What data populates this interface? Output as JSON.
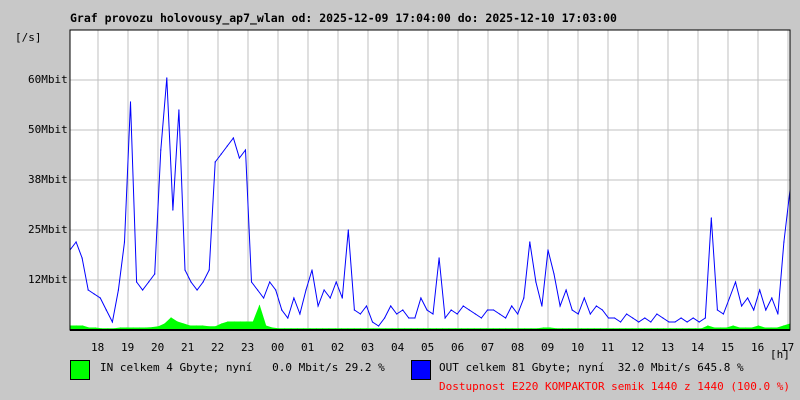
{
  "chart_data": {
    "type": "line",
    "title": "Graf provozu holovousy_ap7_wlan od: 2025-12-09 17:04:00 do: 2025-12-10 17:03:00",
    "ylabel": "[/s]",
    "xlabel": "[h]",
    "ylim": [
      0,
      75
    ],
    "y_unit": "Mbit",
    "yticks": [
      {
        "value": 12.5,
        "label": "12Mbit"
      },
      {
        "value": 25,
        "label": "25Mbit"
      },
      {
        "value": 37.5,
        "label": "38Mbit"
      },
      {
        "value": 50,
        "label": "50Mbit"
      },
      {
        "value": 62.5,
        "label": "60Mbit"
      }
    ],
    "xticks": [
      "18",
      "19",
      "20",
      "21",
      "22",
      "23",
      "00",
      "01",
      "02",
      "03",
      "04",
      "05",
      "06",
      "07",
      "08",
      "09",
      "10",
      "11",
      "12",
      "13",
      "14",
      "15",
      "16",
      "17"
    ],
    "x_start_hour_offset": 0.933,
    "samples_per_hour": 5,
    "grid": true,
    "series": [
      {
        "name": "IN",
        "color": "#00ff00",
        "fill": true,
        "values": [
          1,
          1,
          1,
          0.5,
          0.5,
          0.3,
          0.3,
          0.3,
          0.5,
          0.5,
          0.5,
          0.5,
          0.5,
          0.6,
          0.8,
          1.5,
          3,
          2,
          1.5,
          1,
          1,
          1,
          0.8,
          0.8,
          1.5,
          2,
          2,
          2,
          2,
          2,
          6,
          1,
          0.5,
          0.3,
          0.3,
          0.3,
          0.3,
          0.3,
          0.3,
          0.3,
          0.3,
          0.3,
          0.3,
          0.3,
          0.3,
          0.3,
          0.3,
          0.3,
          0.3,
          0.3,
          0.3,
          0.3,
          0.3,
          0.3,
          0.3,
          0.3,
          0.3,
          0.3,
          0.3,
          0.3,
          0.3,
          0.3,
          0.3,
          0.3,
          0.3,
          0.3,
          0.3,
          0.3,
          0.3,
          0.3,
          0.3,
          0.3,
          0.3,
          0.3,
          0.3,
          0.5,
          0.5,
          0.3,
          0.3,
          0.3,
          0.3,
          0.3,
          0.3,
          0.3,
          0.3,
          0.3,
          0.3,
          0.3,
          0.3,
          0.3,
          0.3,
          0.3,
          0.3,
          0.3,
          0.3,
          0.3,
          0.3,
          0.3,
          0.3,
          0.3,
          0.3,
          1,
          0.5,
          0.5,
          0.5,
          1,
          0.5,
          0.5,
          0.5,
          1,
          0.5,
          0.5,
          0.5,
          1,
          1.5
        ]
      },
      {
        "name": "OUT",
        "color": "#0000ff",
        "fill": false,
        "values": [
          20,
          22,
          18,
          10,
          9,
          8,
          5,
          2,
          10,
          22,
          57,
          12,
          10,
          12,
          14,
          45,
          63,
          30,
          55,
          15,
          12,
          10,
          12,
          15,
          42,
          44,
          46,
          48,
          43,
          45,
          12,
          10,
          8,
          12,
          10,
          5,
          3,
          8,
          4,
          10,
          15,
          6,
          10,
          8,
          12,
          8,
          25,
          5,
          4,
          6,
          2,
          1,
          3,
          6,
          4,
          5,
          3,
          3,
          8,
          5,
          4,
          18,
          3,
          5,
          4,
          6,
          5,
          4,
          3,
          5,
          5,
          4,
          3,
          6,
          4,
          8,
          22,
          12,
          6,
          20,
          14,
          6,
          10,
          5,
          4,
          8,
          4,
          6,
          5,
          3,
          3,
          2,
          4,
          3,
          2,
          3,
          2,
          4,
          3,
          2,
          2,
          3,
          2,
          3,
          2,
          3,
          28,
          5,
          4,
          8,
          12,
          6,
          8,
          5,
          10,
          5,
          8,
          4,
          22,
          35
        ]
      }
    ]
  },
  "legend": {
    "in_text": "IN celkem 4 Gbyte; nyní   0.0 Mbit/s 29.2 %",
    "out_text": "OUT celkem 81 Gbyte; nyní  32.0 Mbit/s 645.8 %",
    "availability": "Dostupnost E220 KOMPAKTOR semik 1440 z 1440 (100.0 %)",
    "in_color": "#00ff00",
    "out_color": "#0000ff",
    "availability_color": "#ff0000"
  }
}
